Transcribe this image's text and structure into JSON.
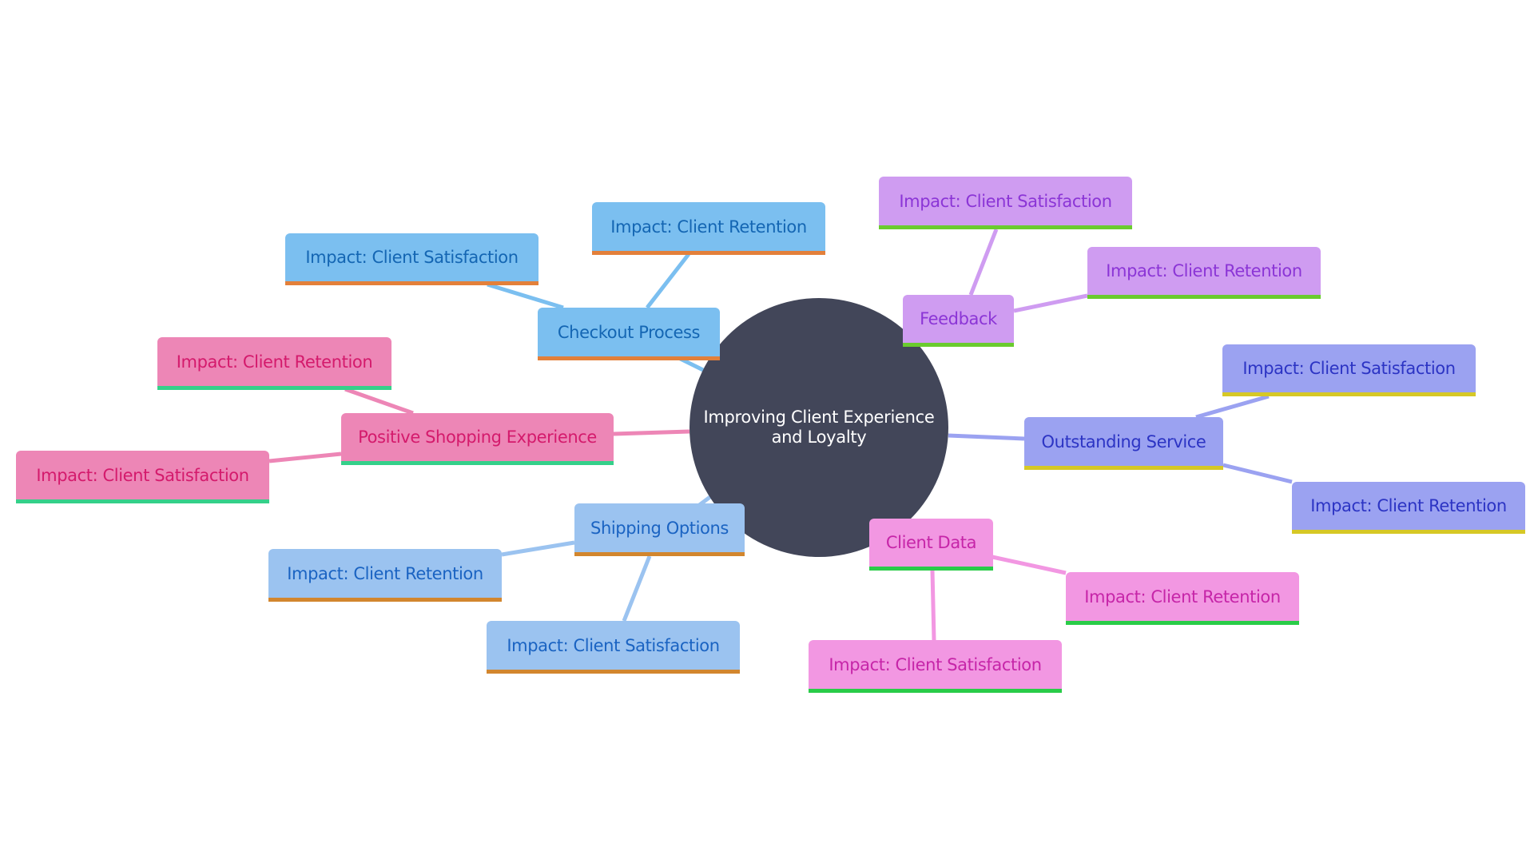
{
  "root": {
    "label_line1": "Improving Client Experience",
    "label_line2": "and Loyalty",
    "color": "#424659"
  },
  "branches": [
    {
      "id": "checkout",
      "label": "Checkout Process",
      "fill": "#7bbff0",
      "text": "#1466b3",
      "underline": "#e3803a",
      "edge": "#7bbff0",
      "children": [
        {
          "label": "Impact: Client Satisfaction"
        },
        {
          "label": "Impact: Client Retention"
        }
      ]
    },
    {
      "id": "feedback",
      "label": "Feedback",
      "fill": "#cf9cf1",
      "text": "#8b35d6",
      "underline": "#6acb2e",
      "edge": "#cf9cf1",
      "children": [
        {
          "label": "Impact: Client Satisfaction"
        },
        {
          "label": "Impact: Client Retention"
        }
      ]
    },
    {
      "id": "outstanding-service",
      "label": "Outstanding Service",
      "fill": "#9ba2f1",
      "text": "#2c34c4",
      "underline": "#d6c826",
      "edge": "#9ba2f1",
      "children": [
        {
          "label": "Impact: Client Satisfaction"
        },
        {
          "label": "Impact: Client Retention"
        }
      ]
    },
    {
      "id": "client-data",
      "label": "Client Data",
      "fill": "#f297e2",
      "text": "#c625a8",
      "underline": "#29cc48",
      "edge": "#f297e2",
      "children": [
        {
          "label": "Impact: Client Retention"
        },
        {
          "label": "Impact: Client Satisfaction"
        }
      ]
    },
    {
      "id": "shipping-options",
      "label": "Shipping Options",
      "fill": "#9bc3f0",
      "text": "#1a63c2",
      "underline": "#d2862e",
      "edge": "#9bc3f0",
      "children": [
        {
          "label": "Impact: Client Retention"
        },
        {
          "label": "Impact: Client Satisfaction"
        }
      ]
    },
    {
      "id": "positive-shopping",
      "label": "Positive Shopping Experience",
      "fill": "#ed86b6",
      "text": "#d41a6c",
      "underline": "#35d08a",
      "edge": "#ed86b6",
      "children": [
        {
          "label": "Impact: Client Retention"
        },
        {
          "label": "Impact: Client Satisfaction"
        }
      ]
    }
  ]
}
